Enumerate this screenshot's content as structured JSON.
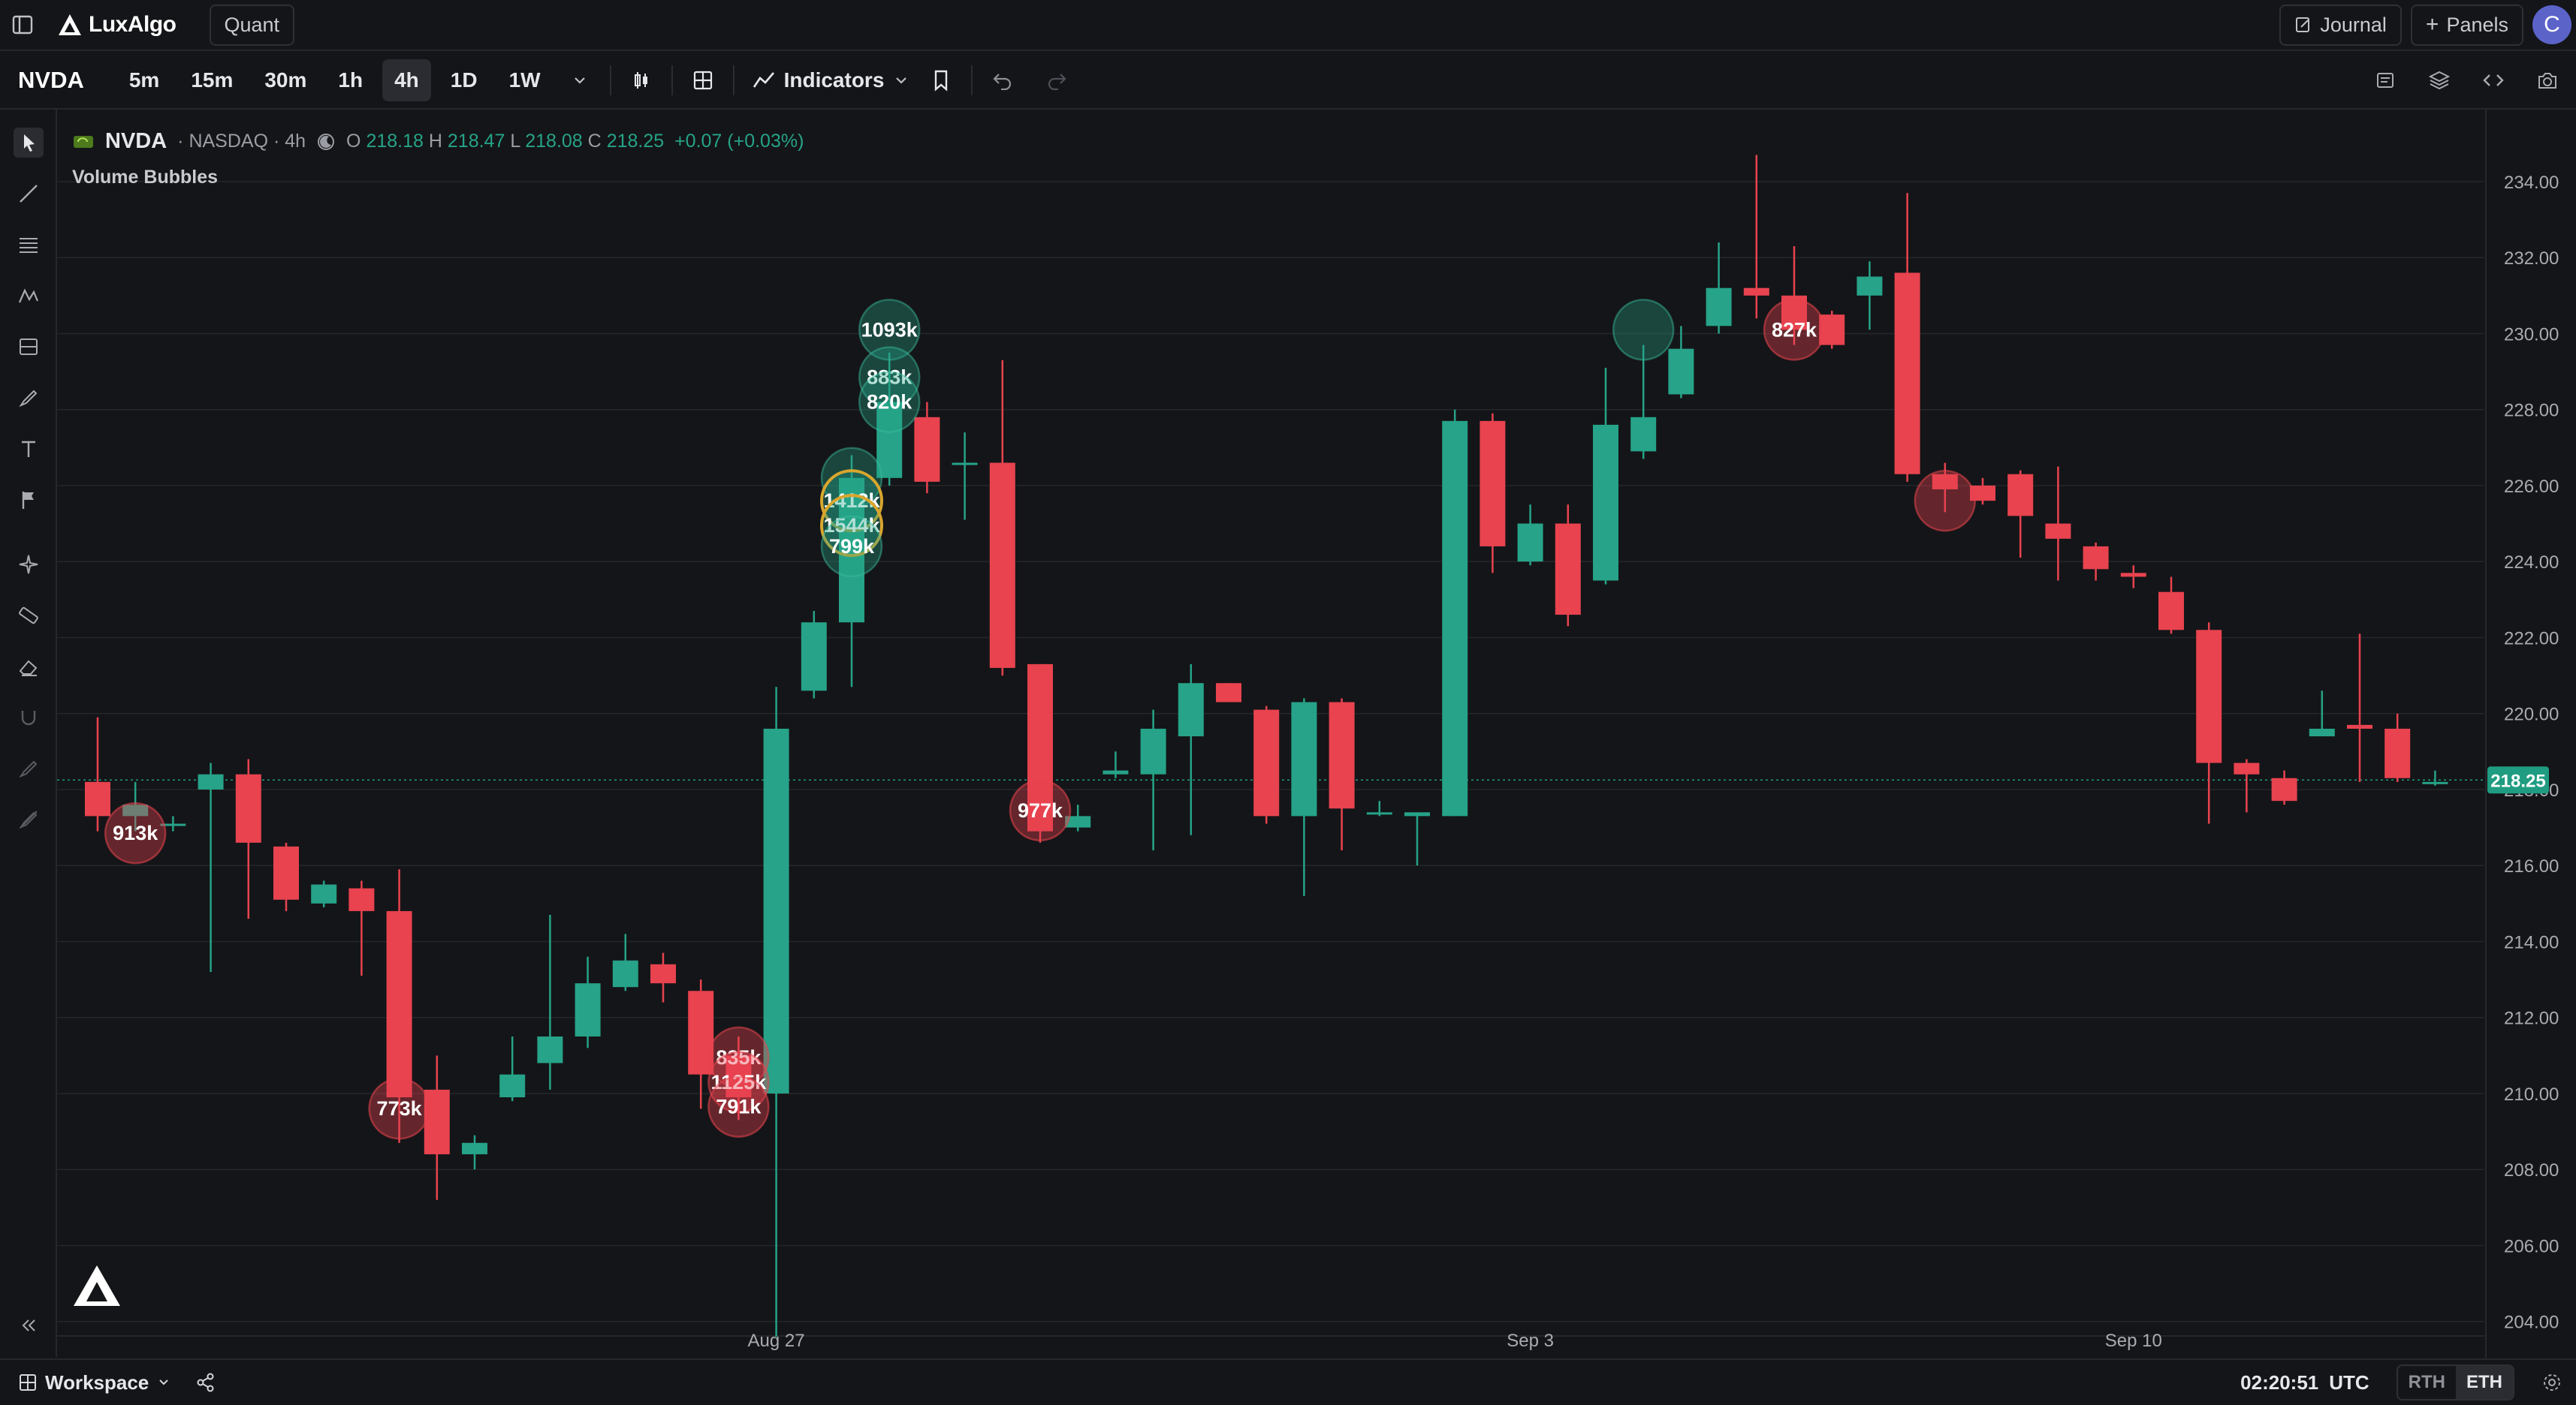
{
  "topbar": {
    "brand": "LuxAlgo",
    "mode": "Quant",
    "journal": "Journal",
    "panels": "Panels",
    "avatar_initial": "C"
  },
  "toolbar": {
    "symbol": "NVDA",
    "timeframes": [
      "5m",
      "15m",
      "30m",
      "1h",
      "4h",
      "1D",
      "1W"
    ],
    "active_timeframe": "4h",
    "indicators_label": "Indicators"
  },
  "legend": {
    "symbol": "NVDA",
    "exchange_interval": "· NASDAQ · 4h",
    "open_key": "O",
    "open": "218.18",
    "high_key": "H",
    "high": "218.47",
    "low_key": "L",
    "low": "218.08",
    "close_key": "C",
    "close": "218.25",
    "change": "+0.07 (+0.03%)",
    "indicator": "Volume Bubbles"
  },
  "bottombar": {
    "workspace": "Workspace",
    "time": "02:20:51",
    "timezone": "UTC",
    "session_rth": "RTH",
    "session_eth": "ETH"
  },
  "colors": {
    "up": "#26a388",
    "down": "#e8434f",
    "background": "#141518",
    "grid": "#24262b",
    "price_tag": "#1f9c81"
  },
  "chart_data": {
    "type": "candlestick",
    "ylim": [
      203.5,
      235.5
    ],
    "y_ticks": [
      "234.00",
      "232.00",
      "230.00",
      "228.00",
      "226.00",
      "224.00",
      "222.00",
      "220.00",
      "218.00",
      "216.00",
      "214.00",
      "212.00",
      "210.00",
      "208.00",
      "206.00",
      "204.00"
    ],
    "x_labels": [
      {
        "index": 18,
        "label": "Aug 27"
      },
      {
        "index": 38,
        "label": "Sep 3"
      },
      {
        "index": 54,
        "label": "Sep 10"
      }
    ],
    "last_price": "218.25",
    "candles": [
      [
        218.2,
        217.3,
        219.9,
        216.9
      ],
      [
        217.3,
        217.6,
        218.2,
        216.9
      ],
      [
        217.1,
        217.1,
        217.3,
        216.9
      ],
      [
        218.0,
        218.4,
        218.7,
        213.2
      ],
      [
        218.4,
        216.6,
        218.8,
        214.6
      ],
      [
        216.5,
        215.1,
        216.6,
        214.8
      ],
      [
        215.0,
        215.5,
        215.6,
        214.9
      ],
      [
        215.4,
        214.8,
        215.6,
        213.1
      ],
      [
        214.8,
        209.9,
        215.9,
        208.7
      ],
      [
        210.1,
        208.4,
        211.0,
        207.2
      ],
      [
        208.4,
        208.7,
        208.9,
        208.0
      ],
      [
        209.9,
        210.5,
        211.5,
        209.8
      ],
      [
        210.8,
        211.5,
        214.7,
        210.1
      ],
      [
        211.5,
        212.9,
        213.6,
        211.2
      ],
      [
        212.8,
        213.5,
        214.2,
        212.7
      ],
      [
        213.4,
        212.9,
        213.7,
        212.4
      ],
      [
        212.7,
        210.5,
        213.0,
        209.6
      ],
      [
        211.0,
        209.9,
        211.5,
        209.3
      ],
      [
        210.0,
        219.6,
        220.7,
        203.6
      ],
      [
        220.6,
        222.4,
        222.7,
        220.4
      ],
      [
        222.4,
        226.2,
        226.8,
        220.7
      ],
      [
        226.2,
        228.2,
        229.5,
        226.0
      ],
      [
        227.8,
        226.1,
        228.2,
        225.8
      ],
      [
        226.6,
        226.6,
        227.4,
        225.1
      ],
      [
        226.6,
        221.2,
        229.3,
        221.0
      ],
      [
        221.3,
        216.9,
        221.3,
        216.6
      ],
      [
        217.0,
        217.3,
        217.6,
        216.9
      ],
      [
        218.4,
        218.5,
        219.0,
        218.3
      ],
      [
        218.4,
        219.6,
        220.1,
        216.4
      ],
      [
        219.4,
        220.8,
        221.3,
        216.8
      ],
      [
        220.8,
        220.3,
        220.8,
        220.3
      ],
      [
        220.1,
        217.3,
        220.2,
        217.1
      ],
      [
        217.3,
        220.3,
        220.4,
        215.2
      ],
      [
        220.3,
        217.5,
        220.4,
        216.4
      ],
      [
        217.4,
        217.4,
        217.7,
        217.3
      ],
      [
        217.3,
        217.4,
        217.4,
        216.0
      ],
      [
        217.3,
        227.7,
        228.0,
        217.3
      ],
      [
        227.7,
        224.4,
        227.9,
        223.7
      ],
      [
        224.0,
        225.0,
        225.5,
        223.9
      ],
      [
        225.0,
        222.6,
        225.5,
        222.3
      ],
      [
        223.5,
        227.6,
        229.1,
        223.4
      ],
      [
        226.9,
        227.8,
        229.7,
        226.7
      ],
      [
        228.4,
        229.6,
        230.2,
        228.3
      ],
      [
        230.2,
        231.2,
        232.4,
        230.0
      ],
      [
        231.2,
        231.0,
        234.7,
        230.4
      ],
      [
        231.0,
        230.1,
        232.3,
        229.7
      ],
      [
        230.5,
        229.7,
        230.6,
        229.6
      ],
      [
        231.0,
        231.5,
        231.9,
        230.1
      ],
      [
        231.6,
        226.3,
        233.7,
        226.1
      ],
      [
        226.3,
        225.9,
        226.6,
        225.3
      ],
      [
        226.0,
        225.6,
        226.2,
        225.5
      ],
      [
        226.3,
        225.2,
        226.4,
        224.1
      ],
      [
        225.0,
        224.6,
        226.5,
        223.5
      ],
      [
        224.4,
        223.8,
        224.5,
        223.5
      ],
      [
        223.7,
        223.6,
        223.9,
        223.3
      ],
      [
        223.2,
        222.2,
        223.6,
        222.1
      ],
      [
        222.2,
        218.7,
        222.4,
        217.1
      ],
      [
        218.7,
        218.4,
        218.8,
        217.4
      ],
      [
        218.3,
        217.7,
        218.5,
        217.6
      ],
      [
        219.4,
        219.6,
        220.6,
        219.4
      ],
      [
        219.7,
        219.6,
        222.1,
        218.2
      ],
      [
        219.6,
        218.3,
        220.0,
        218.2
      ],
      [
        218.2,
        218.2,
        218.5,
        218.1
      ]
    ],
    "bubbles": [
      {
        "index": 1,
        "price": 216.85,
        "label": "913k",
        "kind": "down"
      },
      {
        "index": 8,
        "price": 209.6,
        "label": "773k",
        "kind": "down"
      },
      {
        "index": 17,
        "price": 210.95,
        "label": "835k",
        "kind": "down"
      },
      {
        "index": 17,
        "price": 210.3,
        "label": "1125k",
        "kind": "down"
      },
      {
        "index": 17,
        "price": 209.65,
        "label": "791k",
        "kind": "down"
      },
      {
        "index": 20,
        "price": 226.2,
        "label": "",
        "kind": "up"
      },
      {
        "index": 20,
        "price": 225.6,
        "label": "1412k",
        "kind": "hi"
      },
      {
        "index": 20,
        "price": 224.95,
        "label": "1544k",
        "kind": "hi"
      },
      {
        "index": 20,
        "price": 224.4,
        "label": "799k",
        "kind": "up"
      },
      {
        "index": 21,
        "price": 230.1,
        "label": "1093k",
        "kind": "up"
      },
      {
        "index": 21,
        "price": 228.85,
        "label": "883k",
        "kind": "up"
      },
      {
        "index": 21,
        "price": 228.2,
        "label": "820k",
        "kind": "up"
      },
      {
        "index": 25,
        "price": 217.45,
        "label": "977k",
        "kind": "down"
      },
      {
        "index": 41,
        "price": 230.1,
        "label": "",
        "kind": "up"
      },
      {
        "index": 45,
        "price": 230.1,
        "label": "827k",
        "kind": "down"
      },
      {
        "index": 49,
        "price": 225.6,
        "label": "",
        "kind": "down"
      }
    ]
  }
}
